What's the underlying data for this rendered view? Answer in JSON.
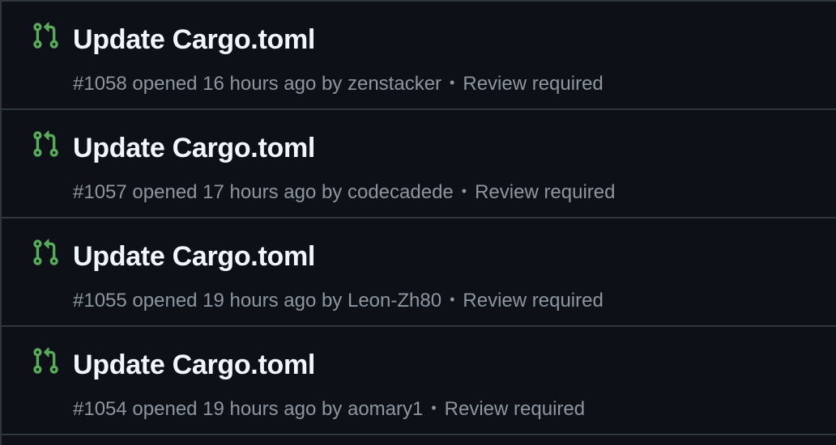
{
  "colors": {
    "background": "#0d1117",
    "border": "#30363d",
    "title": "#f0f6fc",
    "meta": "#8d96a0",
    "open_icon": "#57ab5a"
  },
  "pull_requests": [
    {
      "icon": "git-pull-request-open-icon",
      "title": "Update Cargo.toml",
      "number": "#1058",
      "opened_text": "opened 16 hours ago by",
      "author": "zenstacker",
      "separator": "•",
      "review": "Review required"
    },
    {
      "icon": "git-pull-request-open-icon",
      "title": "Update Cargo.toml",
      "number": "#1057",
      "opened_text": "opened 17 hours ago by",
      "author": "codecadede",
      "separator": "•",
      "review": "Review required"
    },
    {
      "icon": "git-pull-request-open-icon",
      "title": "Update Cargo.toml",
      "number": "#1055",
      "opened_text": "opened 19 hours ago by",
      "author": "Leon-Zh80",
      "separator": "•",
      "review": "Review required"
    },
    {
      "icon": "git-pull-request-open-icon",
      "title": "Update Cargo.toml",
      "number": "#1054",
      "opened_text": "opened 19 hours ago by",
      "author": "aomary1",
      "separator": "•",
      "review": "Review required"
    }
  ]
}
